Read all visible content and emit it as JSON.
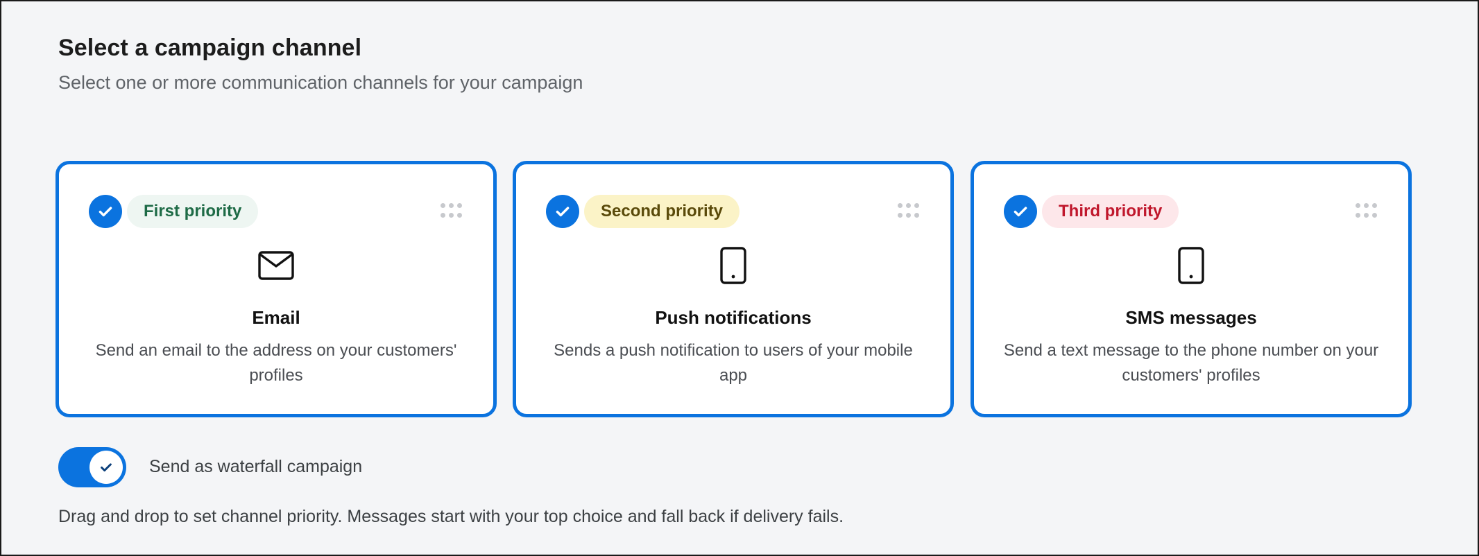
{
  "header": {
    "title": "Select a campaign channel",
    "subtitle": "Select one or more communication channels for your campaign"
  },
  "cards": [
    {
      "selected": true,
      "priority_label": "First priority",
      "priority_color": "#1e6b46",
      "icon": "envelope-icon",
      "title": "Email",
      "description": "Send an email to the address on your customers' profiles"
    },
    {
      "selected": true,
      "priority_label": "Second priority",
      "priority_color": "#5a4a0a",
      "icon": "mobile-phone-icon",
      "title": "Push notifications",
      "description": "Sends a push notification to users of your mobile app"
    },
    {
      "selected": true,
      "priority_label": "Third priority",
      "priority_color": "#c0172c",
      "icon": "mobile-phone-icon",
      "title": "SMS messages",
      "description": "Send a text message to the phone number on your customers' profiles"
    }
  ],
  "waterfall": {
    "enabled": true,
    "label": "Send as waterfall campaign",
    "help": "Drag and drop to set channel priority. Messages start with your top choice and fall back if delivery fails."
  },
  "colors": {
    "accent": "#0b73df",
    "background": "#f4f5f7"
  }
}
